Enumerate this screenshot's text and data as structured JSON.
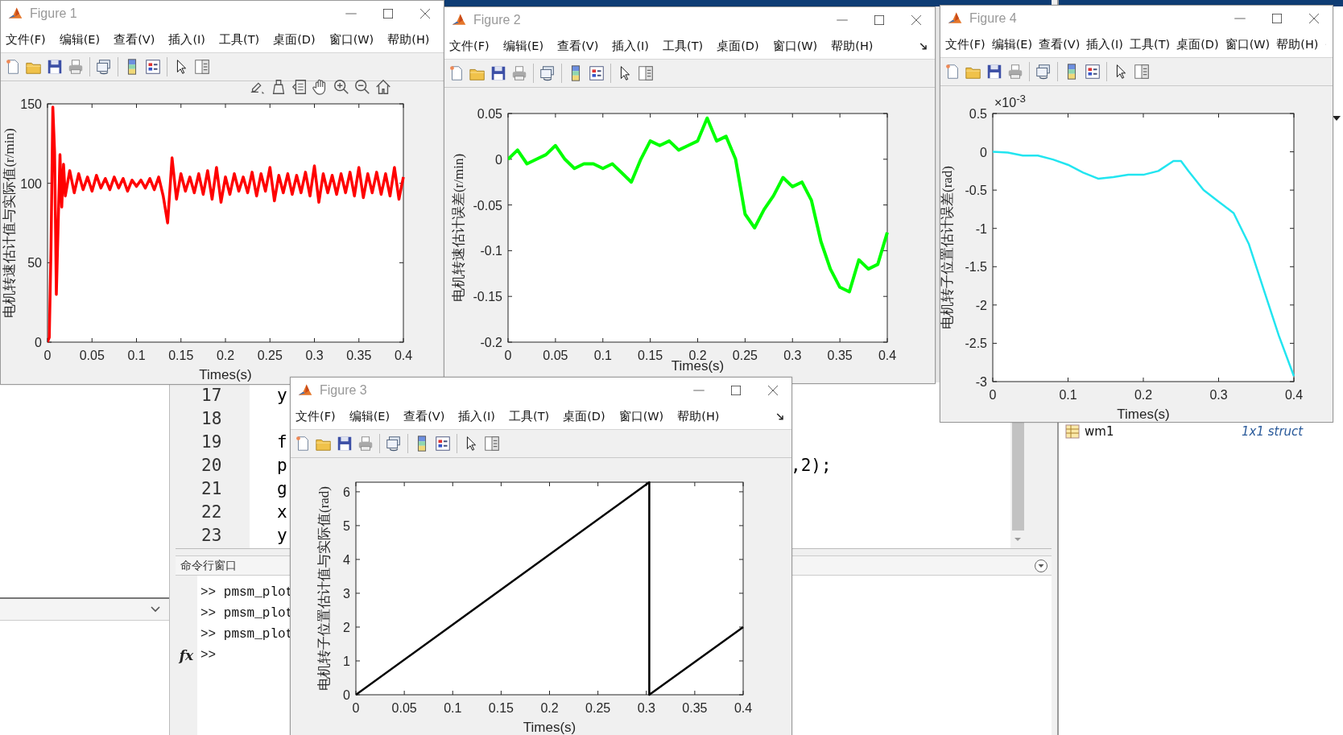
{
  "desktop": {
    "editor": {
      "lines": [
        {
          "number": "17",
          "code": "y"
        },
        {
          "number": "18"
        },
        {
          "number": "19",
          "code": "f"
        },
        {
          "number": "20",
          "code": "p",
          "code_tail": ",2);"
        },
        {
          "number": "21",
          "code": "g"
        },
        {
          "number": "22",
          "code": "x"
        },
        {
          "number": "23",
          "code": "y"
        }
      ]
    },
    "command_window": {
      "title": "命令行窗口",
      "history": [
        ">> pmsm_plot",
        ">> pmsm_plot",
        ">> pmsm_plot"
      ],
      "function_mark": "fx",
      "prompt": ">>"
    },
    "workspace": {
      "variables": [
        {
          "name": "wm1",
          "value": "1x1 struct"
        }
      ]
    }
  },
  "figures": [
    {
      "title": "Figure 1",
      "menu": [
        "文件(F)",
        "编辑(E)",
        "查看(V)",
        "插入(I)",
        "工具(T)",
        "桌面(D)",
        "窗口(W)",
        "帮助(H)"
      ],
      "plot_tools": true,
      "axes": {
        "chart_data": {
          "type": "line",
          "xlabel": "Times(s)",
          "ylabel": "电机转速估计值与实际值(r/min)",
          "xlim": [
            0,
            0.4
          ],
          "ylim": [
            0,
            150
          ],
          "xticks": [
            0,
            0.05,
            0.1,
            0.15,
            0.2,
            0.25,
            0.3,
            0.35,
            0.4
          ],
          "yticks": [
            0,
            50,
            100,
            150
          ],
          "x": [
            0,
            0.002,
            0.004,
            0.006,
            0.008,
            0.01,
            0.012,
            0.014,
            0.016,
            0.018,
            0.02,
            0.025,
            0.03,
            0.035,
            0.04,
            0.045,
            0.05,
            0.055,
            0.06,
            0.065,
            0.07,
            0.075,
            0.08,
            0.085,
            0.09,
            0.095,
            0.1,
            0.105,
            0.11,
            0.115,
            0.12,
            0.125,
            0.13,
            0.135,
            0.14,
            0.145,
            0.15,
            0.155,
            0.16,
            0.165,
            0.17,
            0.175,
            0.18,
            0.185,
            0.19,
            0.195,
            0.2,
            0.205,
            0.21,
            0.215,
            0.22,
            0.225,
            0.23,
            0.235,
            0.24,
            0.245,
            0.25,
            0.255,
            0.26,
            0.265,
            0.27,
            0.275,
            0.28,
            0.285,
            0.29,
            0.295,
            0.3,
            0.305,
            0.31,
            0.315,
            0.32,
            0.325,
            0.33,
            0.335,
            0.34,
            0.345,
            0.35,
            0.355,
            0.36,
            0.365,
            0.37,
            0.375,
            0.38,
            0.385,
            0.39,
            0.395,
            0.4
          ],
          "series": [
            {
              "color": "#ff0000",
              "values": [
                0,
                3,
                60,
                148,
                120,
                30,
                75,
                118,
                85,
                112,
                92,
                108,
                94,
                106,
                96,
                104,
                95,
                105,
                97,
                103,
                96,
                104,
                97,
                103,
                95,
                102,
                98,
                102,
                97,
                103,
                96,
                104,
                92,
                75,
                116,
                90,
                106,
                95,
                104,
                94,
                106,
                93,
                108,
                90,
                110,
                88,
                104,
                93,
                106,
                95,
                104,
                94,
                107,
                92,
                106,
                95,
                110,
                89,
                105,
                94,
                106,
                93,
                105,
                94,
                107,
                92,
                111,
                88,
                106,
                94,
                105,
                93,
                106,
                94,
                107,
                92,
                110,
                91,
                106,
                94,
                107,
                93,
                106,
                92,
                110,
                90,
                104
              ]
            }
          ]
        }
      }
    },
    {
      "title": "Figure 2",
      "menu": [
        "文件(F)",
        "编辑(E)",
        "查看(V)",
        "插入(I)",
        "工具(T)",
        "桌面(D)",
        "窗口(W)",
        "帮助(H)"
      ],
      "plot_tools": false,
      "axes": {
        "chart_data": {
          "type": "line",
          "xlabel": "Times(s)",
          "ylabel": "电机转速估计误差(r/min)",
          "xlim": [
            0,
            0.4
          ],
          "ylim": [
            -0.2,
            0.05
          ],
          "xticks": [
            0,
            0.05,
            0.1,
            0.15,
            0.2,
            0.25,
            0.3,
            0.35,
            0.4
          ],
          "yticks": [
            -0.2,
            -0.15,
            -0.1,
            -0.05,
            0,
            0.05
          ],
          "x": [
            0,
            0.01,
            0.02,
            0.03,
            0.04,
            0.05,
            0.06,
            0.07,
            0.08,
            0.09,
            0.1,
            0.11,
            0.12,
            0.13,
            0.14,
            0.15,
            0.16,
            0.17,
            0.18,
            0.19,
            0.2,
            0.21,
            0.22,
            0.23,
            0.24,
            0.25,
            0.26,
            0.27,
            0.28,
            0.29,
            0.3,
            0.31,
            0.32,
            0.33,
            0.34,
            0.35,
            0.36,
            0.37,
            0.38,
            0.39,
            0.4
          ],
          "series": [
            {
              "color": "#00ff00",
              "values": [
                0,
                0.01,
                -0.005,
                0,
                0.005,
                0.015,
                0,
                -0.01,
                -0.005,
                -0.005,
                -0.01,
                -0.005,
                -0.015,
                -0.025,
                0,
                0.02,
                0.015,
                0.02,
                0.01,
                0.015,
                0.02,
                0.045,
                0.02,
                0.025,
                0,
                -0.06,
                -0.075,
                -0.055,
                -0.04,
                -0.02,
                -0.03,
                -0.025,
                -0.045,
                -0.09,
                -0.12,
                -0.14,
                -0.145,
                -0.11,
                -0.12,
                -0.115,
                -0.08
              ]
            }
          ]
        }
      }
    },
    {
      "title": "Figure 4",
      "menu": [
        "文件(F)",
        "编辑(E)",
        "查看(V)",
        "插入(I)",
        "工具(T)",
        "桌面(D)",
        "窗口(W)",
        "帮助(H)"
      ],
      "plot_tools": false,
      "axes": {
        "exponent": "×10$^{-3}$",
        "chart_data": {
          "type": "line",
          "xlabel": "Times(s)",
          "ylabel": "电机转子位置估计误差(rad)",
          "xlim": [
            0,
            0.4
          ],
          "ylim": [
            -3,
            0.5
          ],
          "xticks": [
            0,
            0.1,
            0.2,
            0.3,
            0.4
          ],
          "yticks": [
            -3,
            -2.5,
            -2,
            -1.5,
            -1,
            -0.5,
            0,
            0.5
          ],
          "x": [
            0,
            0.02,
            0.04,
            0.06,
            0.08,
            0.1,
            0.12,
            0.14,
            0.16,
            0.18,
            0.2,
            0.22,
            0.24,
            0.25,
            0.26,
            0.28,
            0.3,
            0.32,
            0.34,
            0.36,
            0.38,
            0.4
          ],
          "series": [
            {
              "color": "#22e5f0",
              "values": [
                0,
                -0.01,
                -0.05,
                -0.05,
                -0.1,
                -0.17,
                -0.27,
                -0.35,
                -0.33,
                -0.3,
                -0.3,
                -0.25,
                -0.12,
                -0.12,
                -0.25,
                -0.5,
                -0.65,
                -0.8,
                -1.2,
                -1.8,
                -2.4,
                -2.93
              ]
            }
          ]
        }
      }
    },
    {
      "title": "Figure 3",
      "menu": [
        "文件(F)",
        "编辑(E)",
        "查看(V)",
        "插入(I)",
        "工具(T)",
        "桌面(D)",
        "窗口(W)",
        "帮助(H)"
      ],
      "plot_tools": false,
      "axes": {
        "chart_data": {
          "type": "line",
          "xlabel": "Times(s)",
          "ylabel": "电机转子位置估计值与实际值(rad)",
          "xlim": [
            0,
            0.4
          ],
          "ylim": [
            0,
            6.2832
          ],
          "xticks": [
            0,
            0.05,
            0.1,
            0.15,
            0.2,
            0.25,
            0.3,
            0.35,
            0.4
          ],
          "yticks": [
            0,
            1,
            2,
            3,
            4,
            5,
            6
          ],
          "x": [
            0,
            0.303,
            0.303,
            0.4
          ],
          "series": [
            {
              "color": "#000000",
              "values": [
                0,
                6.28,
                0,
                2
              ]
            }
          ]
        }
      }
    }
  ]
}
